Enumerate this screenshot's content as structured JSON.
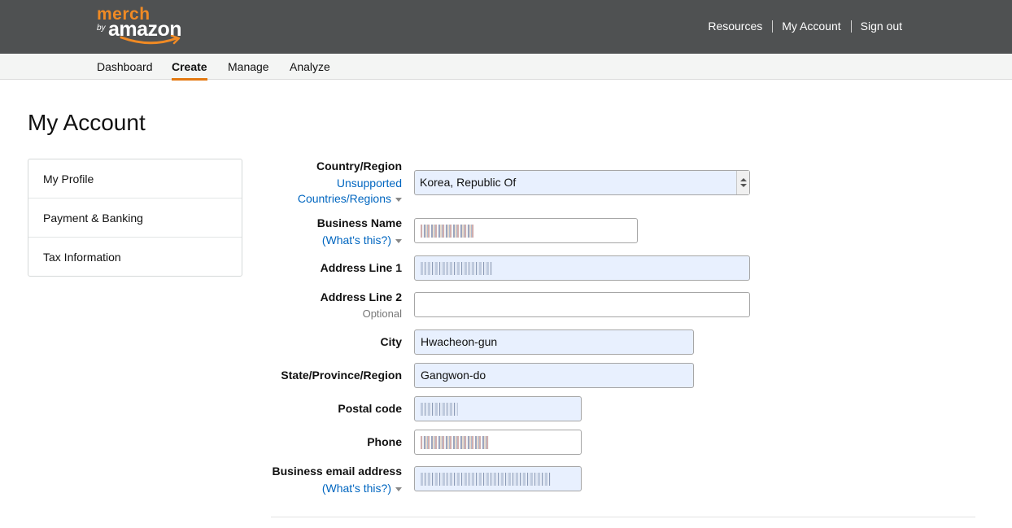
{
  "brand": {
    "merch": "merch",
    "by": "by",
    "amazon": "amazon"
  },
  "header": {
    "links": [
      {
        "label": "Resources"
      },
      {
        "label": "My Account"
      },
      {
        "label": "Sign out"
      }
    ]
  },
  "nav": {
    "tabs": [
      {
        "label": "Dashboard",
        "active": false
      },
      {
        "label": "Create",
        "active": true
      },
      {
        "label": "Manage",
        "active": false
      },
      {
        "label": "Analyze",
        "active": false
      }
    ]
  },
  "page": {
    "title": "My Account"
  },
  "sidebar": {
    "items": [
      {
        "label": "My Profile"
      },
      {
        "label": "Payment & Banking"
      },
      {
        "label": "Tax Information"
      }
    ]
  },
  "form": {
    "country": {
      "label": "Country/Region",
      "link_line1": "Unsupported",
      "link_line2": "Countries/Regions",
      "value": "Korea, Republic Of"
    },
    "business_name": {
      "label": "Business Name",
      "link": "(What's this?)",
      "value": ""
    },
    "address1": {
      "label": "Address Line 1",
      "value": ""
    },
    "address2": {
      "label": "Address Line 2",
      "hint": "Optional",
      "value": ""
    },
    "city": {
      "label": "City",
      "value": "Hwacheon-gun"
    },
    "state": {
      "label": "State/Province/Region",
      "value": "Gangwon-do"
    },
    "postal": {
      "label": "Postal code",
      "value": ""
    },
    "phone": {
      "label": "Phone",
      "value": ""
    },
    "email": {
      "label": "Business email address",
      "link": "(What's this?)",
      "value": ""
    }
  },
  "colors": {
    "topbar": "#4f5152",
    "accent": "#e47911",
    "link": "#0066c0",
    "autofill": "#e8f0fe"
  }
}
